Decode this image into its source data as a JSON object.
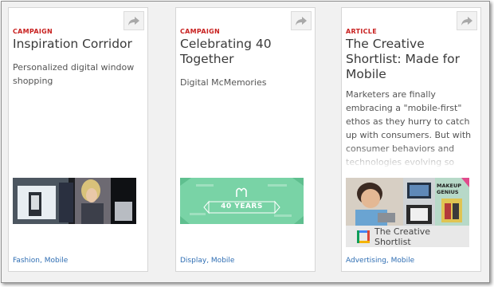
{
  "cards": [
    {
      "tag": "CAMPAIGN",
      "title": "Inspiration Corridor",
      "description": "Personalized digital window shopping",
      "categories": [
        "Fashion",
        "Mobile"
      ]
    },
    {
      "tag": "CAMPAIGN",
      "title": "Celebrating 40 Together",
      "description": "Digital McMemories",
      "image_text": "40 YEARS",
      "categories": [
        "Display",
        "Mobile"
      ]
    },
    {
      "tag": "ARTICLE",
      "title": "The Creative Shortlist: Made for Mobile",
      "description": "Marketers are finally embracing a \"mobile-first\" ethos as they hurry to catch up with consumers. But with consumer behaviors and technologies evolving so quickly, it can be difficult to",
      "image_badge": "MAKEUP GENIUS",
      "image_caption": "The Creative Shortlist",
      "categories": [
        "Advertising",
        "Mobile"
      ]
    }
  ],
  "share_icon": "share-arrow-icon",
  "category_separator": ", ",
  "colors": {
    "tag": "#c8201f",
    "link": "#2f6eb3",
    "mc_green": "#79d3a6"
  }
}
